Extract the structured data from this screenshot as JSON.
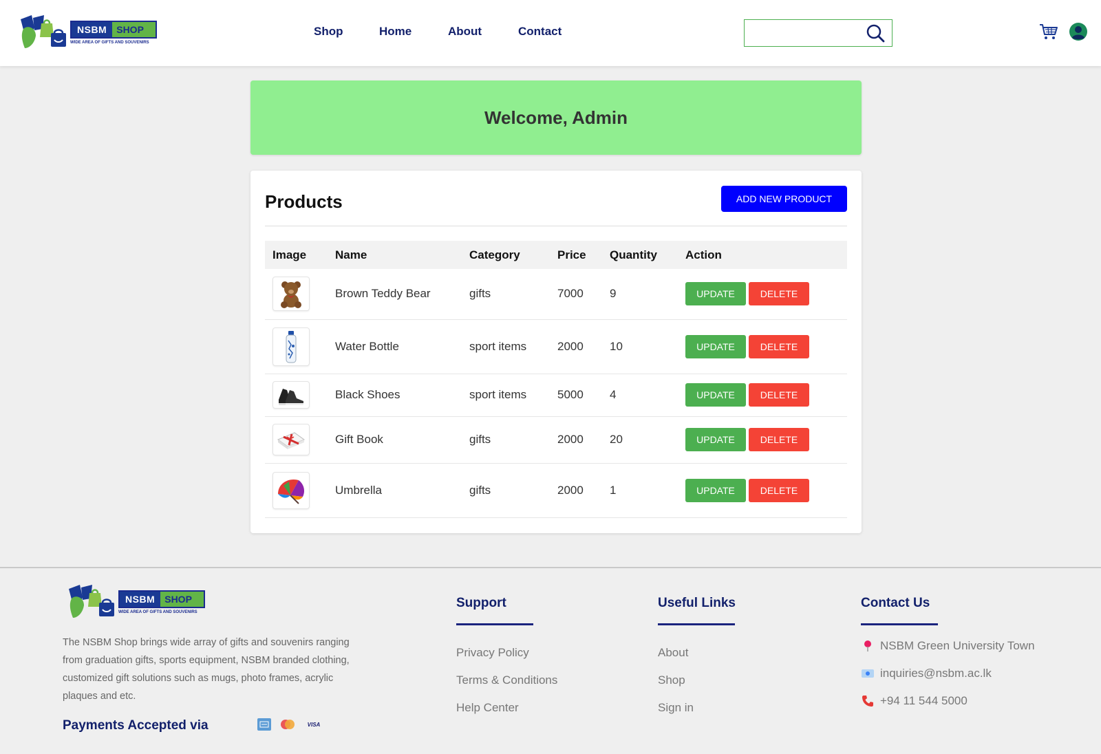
{
  "brand": {
    "badge_left": "NSBM",
    "badge_right": "SHOP",
    "tagline": "WIDE AREA OF GIFTS AND SOUVENIRS",
    "colors": {
      "navy": "#1a2b8f",
      "green": "#62b447",
      "blue_mark": "#1a3a94"
    }
  },
  "nav": {
    "items": [
      {
        "label": "Shop"
      },
      {
        "label": "Home"
      },
      {
        "label": "About"
      },
      {
        "label": "Contact"
      }
    ]
  },
  "search": {
    "value": "",
    "placeholder": "",
    "icon": "search-icon"
  },
  "header_icons": [
    "cart-icon",
    "user-icon"
  ],
  "welcome": {
    "text": "Welcome, Admin",
    "bg": "#90ee90"
  },
  "products": {
    "title": "Products",
    "add_button": "ADD NEW PRODUCT",
    "columns": [
      "Image",
      "Name",
      "Category",
      "Price",
      "Quantity",
      "Action"
    ],
    "update_label": "UPDATE",
    "delete_label": "DELETE",
    "rows": [
      {
        "name": "Brown Teddy Bear",
        "category": "gifts",
        "price": "7000",
        "quantity": "9",
        "image": "teddy-bear-image"
      },
      {
        "name": "Water Bottle",
        "category": "sport items",
        "price": "2000",
        "quantity": "10",
        "image": "water-bottle-image"
      },
      {
        "name": "Black Shoes",
        "category": "sport items",
        "price": "5000",
        "quantity": "4",
        "image": "shoes-image"
      },
      {
        "name": "Gift Book",
        "category": "gifts",
        "price": "2000",
        "quantity": "20",
        "image": "gift-book-image"
      },
      {
        "name": "Umbrella",
        "category": "gifts",
        "price": "2000",
        "quantity": "1",
        "image": "umbrella-image"
      }
    ],
    "colors": {
      "add": "#0000ff",
      "update": "#4caf50",
      "delete": "#f44336"
    }
  },
  "footer": {
    "description": "The NSBM Shop brings wide array of gifts and souvenirs ranging from graduation gifts, sports equipment, NSBM branded clothing, customized gift solutions such as mugs, photo frames, acrylic plaques and etc.",
    "payments_label": "Payments Accepted via",
    "payment_icons": [
      "amex-icon",
      "mastercard-icon",
      "visa-icon"
    ],
    "visa_text": "VISA",
    "support": {
      "title": "Support",
      "links": [
        "Privacy Policy",
        "Terms & Conditions",
        "Help Center"
      ]
    },
    "useful_links": {
      "title": "Useful Links",
      "links": [
        "About",
        "Shop",
        "Sign in"
      ]
    },
    "contact": {
      "title": "Contact Us",
      "address": "NSBM Green University Town",
      "email": "inquiries@nsbm.ac.lk",
      "phone": "+94 11 544 5000"
    }
  }
}
